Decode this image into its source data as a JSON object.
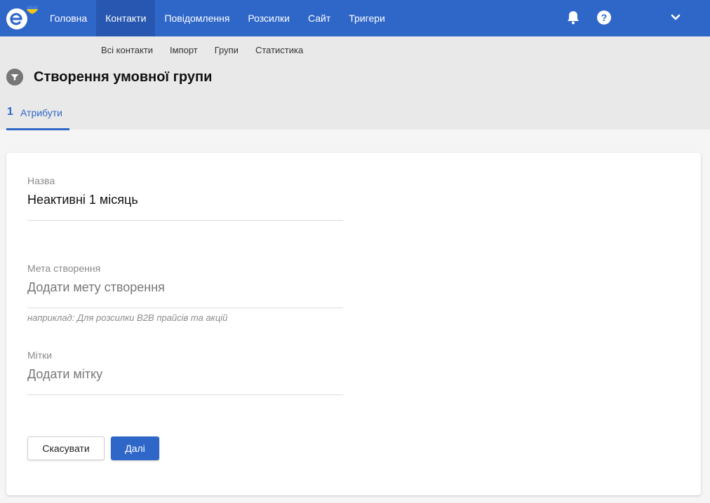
{
  "nav": {
    "items": [
      {
        "label": "Головна"
      },
      {
        "label": "Контакти"
      },
      {
        "label": "Повідомлення"
      },
      {
        "label": "Розсилки"
      },
      {
        "label": "Сайт"
      },
      {
        "label": "Тригери"
      }
    ],
    "active_index": 1,
    "icons": [
      "bell-icon",
      "help-icon",
      "chevron-down-icon"
    ]
  },
  "subnav": {
    "items": [
      {
        "label": "Всі контакти"
      },
      {
        "label": "Імпорт"
      },
      {
        "label": "Групи"
      },
      {
        "label": "Статистика"
      }
    ]
  },
  "page": {
    "title": "Створення умовної групи",
    "icon": "filter-icon"
  },
  "steps": [
    {
      "number": "1",
      "label": "Атрибути"
    }
  ],
  "form": {
    "name": {
      "label": "Назва",
      "value": "Неактивні 1 місяць"
    },
    "goal": {
      "label": "Мета створення",
      "placeholder": "Додати мету створення",
      "hint": "наприклад: Для розсилки B2B прайсів та акцій"
    },
    "tags": {
      "label": "Мітки",
      "placeholder": "Додати мітку"
    }
  },
  "buttons": {
    "cancel": "Скасувати",
    "next": "Далі"
  },
  "colors": {
    "brand": "#2f67c9",
    "brand_active": "#2757b0",
    "logo_flag_blue": "#3b7bd8",
    "logo_flag_yellow": "#f5c518"
  }
}
